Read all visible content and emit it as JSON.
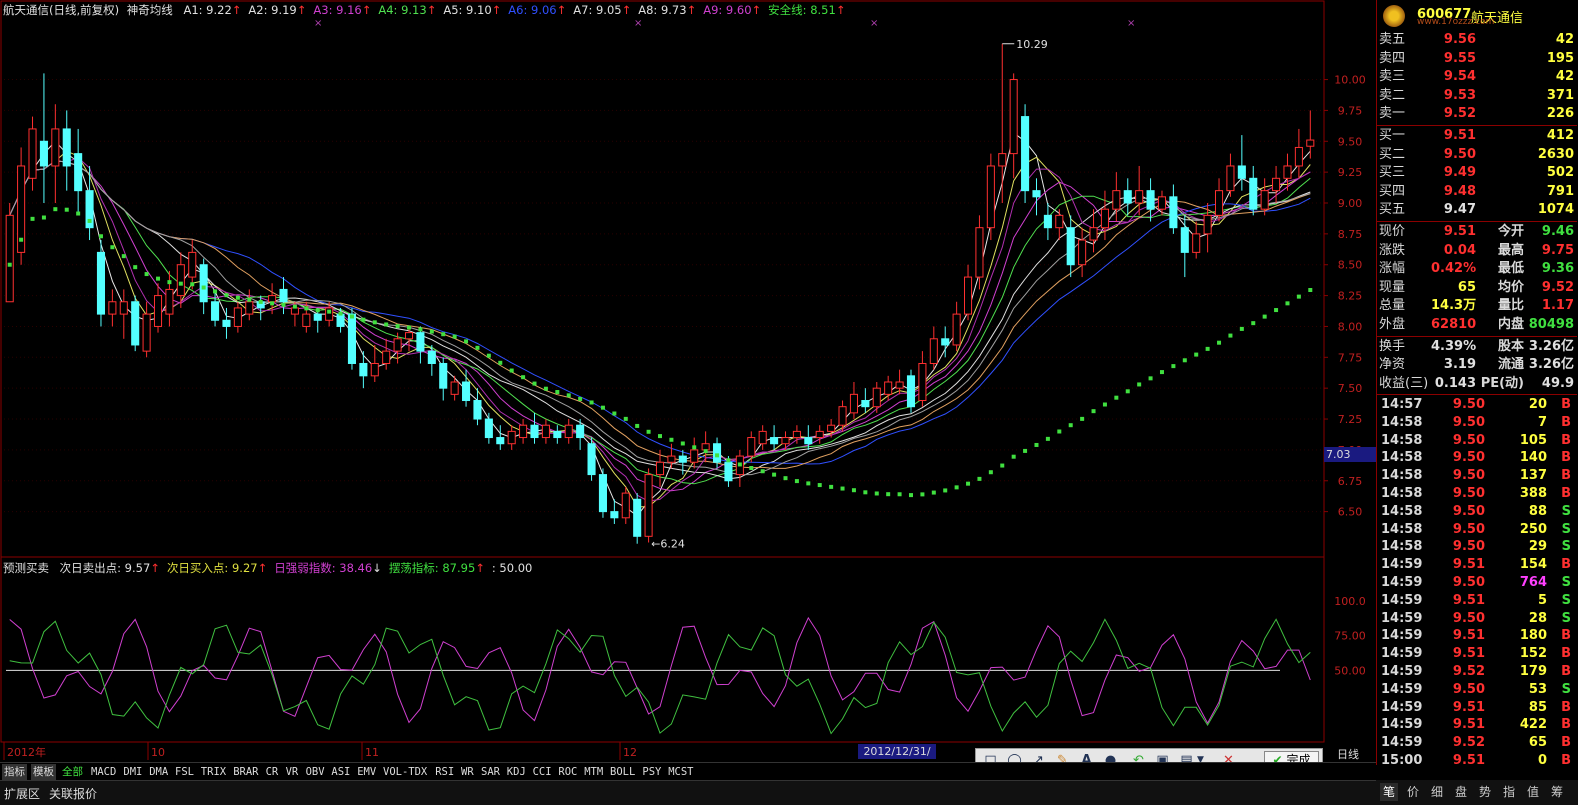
{
  "main_header": {
    "title": "航天通信(日线,前复权)",
    "indicator": "神奇均线",
    "items": [
      {
        "label": "A1: 9.22",
        "arrow": "↑",
        "color": "#e0e0e0"
      },
      {
        "label": "A2: 9.19",
        "arrow": "↑",
        "color": "#e0e0e0"
      },
      {
        "label": "A3: 9.16",
        "arrow": "↑",
        "color": "#d040d0"
      },
      {
        "label": "A4: 9.13",
        "arrow": "↑",
        "color": "#50e050"
      },
      {
        "label": "A5: 9.10",
        "arrow": "↑",
        "color": "#e0e0e0"
      },
      {
        "label": "A6: 9.06",
        "arrow": "↑",
        "color": "#3050ff"
      },
      {
        "label": "A7: 9.05",
        "arrow": "↑",
        "color": "#e0e0e0"
      },
      {
        "label": "A8: 9.73",
        "arrow": "↑",
        "color": "#e0e0e0"
      },
      {
        "label": "A9: 9.60",
        "arrow": "↑",
        "color": "#d040d0"
      },
      {
        "label": "安全线: 8.51",
        "arrow": "↑",
        "color": "#40e040"
      }
    ]
  },
  "sub_header": {
    "title": "预测买卖",
    "items": [
      {
        "label": "次日卖出点: 9.57",
        "arrow": "↑",
        "color": "#e0e0e0"
      },
      {
        "label": "次日买入点: 9.27",
        "arrow": "↑",
        "color": "#e0e040"
      },
      {
        "label": "日强弱指数: 38.46",
        "arrow": "↓",
        "color": "#d040d0"
      },
      {
        "label": "摆荡指标: 87.95",
        "arrow": "↑",
        "color": "#40e040"
      },
      {
        "label": ": 50.00",
        "arrow": "",
        "color": "#e0e0e0"
      }
    ]
  },
  "price_axis": [
    "10.00",
    "9.75",
    "9.50",
    "9.25",
    "9.00",
    "8.75",
    "8.50",
    "8.25",
    "8.00",
    "7.75",
    "7.50",
    "7.25",
    "7.00",
    "6.75",
    "6.50"
  ],
  "crosshair_price": "7.03",
  "osc_axis": [
    "100.0",
    "75.00",
    "50.00"
  ],
  "annotations": {
    "high": "10.29",
    "low": "6.24"
  },
  "time_axis": [
    "2012年",
    "10",
    "11",
    "12"
  ],
  "date_box": "2012/12/31/一",
  "period_label": "日线",
  "stock": {
    "code": "600677",
    "name": "航天通信",
    "watermark": "www.17ozzz.com"
  },
  "asks": [
    {
      "label": "卖五",
      "price": "9.56",
      "vol": "42"
    },
    {
      "label": "卖四",
      "price": "9.55",
      "vol": "195"
    },
    {
      "label": "卖三",
      "price": "9.54",
      "vol": "42"
    },
    {
      "label": "卖二",
      "price": "9.53",
      "vol": "371"
    },
    {
      "label": "卖一",
      "price": "9.52",
      "vol": "226"
    }
  ],
  "bids": [
    {
      "label": "买一",
      "price": "9.51",
      "vol": "412"
    },
    {
      "label": "买二",
      "price": "9.50",
      "vol": "2630"
    },
    {
      "label": "买三",
      "price": "9.49",
      "vol": "502"
    },
    {
      "label": "买四",
      "price": "9.48",
      "vol": "791"
    },
    {
      "label": "买五",
      "price": "9.47",
      "vol": "1074"
    }
  ],
  "quote": [
    {
      "l1": "现价",
      "v1": "9.51",
      "c1": "#ff3030",
      "l2": "今开",
      "v2": "9.46",
      "c2": "#40e040"
    },
    {
      "l1": "涨跌",
      "v1": "0.04",
      "c1": "#ff3030",
      "l2": "最高",
      "v2": "9.75",
      "c2": "#ff3030"
    },
    {
      "l1": "涨幅",
      "v1": "0.42%",
      "c1": "#ff3030",
      "l2": "最低",
      "v2": "9.36",
      "c2": "#40e040"
    },
    {
      "l1": "现量",
      "v1": "65",
      "c1": "#ffff40",
      "l2": "均价",
      "v2": "9.52",
      "c2": "#ff3030"
    },
    {
      "l1": "总量",
      "v1": "14.3万",
      "c1": "#ffff40",
      "l2": "量比",
      "v2": "1.17",
      "c2": "#ff3030"
    },
    {
      "l1": "外盘",
      "v1": "62810",
      "c1": "#ff3030",
      "l2": "内盘",
      "v2": "80498",
      "c2": "#40e040"
    }
  ],
  "fund": [
    {
      "l1": "换手",
      "v1": "4.39%",
      "l2": "股本",
      "v2": "3.26亿"
    },
    {
      "l1": "净资",
      "v1": "3.19",
      "l2": "流通",
      "v2": "3.26亿"
    },
    {
      "l1": "收益(三)",
      "v1": "0.143",
      "l2": "PE(动)",
      "v2": "49.9"
    }
  ],
  "ticks": [
    {
      "t": "14:57",
      "p": "9.50",
      "v": "20",
      "bs": "B",
      "vc": "#ffff40"
    },
    {
      "t": "14:58",
      "p": "9.50",
      "v": "7",
      "bs": "B",
      "vc": "#ffff40"
    },
    {
      "t": "14:58",
      "p": "9.50",
      "v": "105",
      "bs": "B",
      "vc": "#ffff40"
    },
    {
      "t": "14:58",
      "p": "9.50",
      "v": "140",
      "bs": "B",
      "vc": "#ffff40"
    },
    {
      "t": "14:58",
      "p": "9.50",
      "v": "137",
      "bs": "B",
      "vc": "#ffff40"
    },
    {
      "t": "14:58",
      "p": "9.50",
      "v": "388",
      "bs": "B",
      "vc": "#ffff40"
    },
    {
      "t": "14:58",
      "p": "9.50",
      "v": "88",
      "bs": "S",
      "vc": "#ffff40"
    },
    {
      "t": "14:58",
      "p": "9.50",
      "v": "250",
      "bs": "S",
      "vc": "#ffff40"
    },
    {
      "t": "14:58",
      "p": "9.50",
      "v": "29",
      "bs": "S",
      "vc": "#ffff40"
    },
    {
      "t": "14:59",
      "p": "9.51",
      "v": "154",
      "bs": "B",
      "vc": "#ffff40"
    },
    {
      "t": "14:59",
      "p": "9.50",
      "v": "764",
      "bs": "S",
      "vc": "#ff40ff"
    },
    {
      "t": "14:59",
      "p": "9.51",
      "v": "5",
      "bs": "S",
      "vc": "#ffff40"
    },
    {
      "t": "14:59",
      "p": "9.50",
      "v": "28",
      "bs": "S",
      "vc": "#ffff40"
    },
    {
      "t": "14:59",
      "p": "9.51",
      "v": "180",
      "bs": "B",
      "vc": "#ffff40"
    },
    {
      "t": "14:59",
      "p": "9.51",
      "v": "152",
      "bs": "B",
      "vc": "#ffff40"
    },
    {
      "t": "14:59",
      "p": "9.52",
      "v": "179",
      "bs": "B",
      "vc": "#ffff40"
    },
    {
      "t": "14:59",
      "p": "9.50",
      "v": "53",
      "bs": "S",
      "vc": "#ffff40"
    },
    {
      "t": "14:59",
      "p": "9.51",
      "v": "85",
      "bs": "B",
      "vc": "#ffff40"
    },
    {
      "t": "14:59",
      "p": "9.51",
      "v": "422",
      "bs": "B",
      "vc": "#ffff40"
    },
    {
      "t": "14:59",
      "p": "9.52",
      "v": "65",
      "bs": "B",
      "vc": "#ffff40"
    },
    {
      "t": "15:00",
      "p": "9.51",
      "v": "0",
      "bs": "B",
      "vc": "#ffff40"
    }
  ],
  "indicator_tabs": [
    "指标",
    "模板",
    "全部",
    "MACD",
    "DMI",
    "DMA",
    "FSL",
    "TRIX",
    "BRAR",
    "CR",
    "VR",
    "OBV",
    "ASI",
    "EMV",
    "VOL-TDX",
    "RSI",
    "WR",
    "SAR",
    "KDJ",
    "CCI",
    "ROC",
    "MTM",
    "BOLL",
    "PSY",
    "MCST"
  ],
  "bottom_tabs": [
    "扩展区",
    "关联报价"
  ],
  "right_tabs": [
    "笔",
    "价",
    "细",
    "盘",
    "势",
    "指",
    "值",
    "筹"
  ],
  "toolbar_done": "完成",
  "colors": {
    "up": "#ff3030",
    "down": "#54ffff",
    "safety": "#40e040",
    "frame": "#8b0000"
  },
  "chart_data": {
    "type": "line",
    "note_series": "daily OHLC candles (approx)",
    "ohlc": [
      [
        8.2,
        8.9,
        8.2,
        9.0
      ],
      [
        8.6,
        9.3,
        8.5,
        9.45
      ],
      [
        9.2,
        9.6,
        9.1,
        9.7
      ],
      [
        9.5,
        9.3,
        9.0,
        10.05
      ],
      [
        9.3,
        9.6,
        9.0,
        9.8
      ],
      [
        9.6,
        9.3,
        9.1,
        9.75
      ],
      [
        9.4,
        9.1,
        8.9,
        9.6
      ],
      [
        9.1,
        8.8,
        8.7,
        9.3
      ],
      [
        8.6,
        8.1,
        8.0,
        8.7
      ],
      [
        8.1,
        8.2,
        8.0,
        8.3
      ],
      [
        8.1,
        8.2,
        7.9,
        8.3
      ],
      [
        8.2,
        7.85,
        7.8,
        8.25
      ],
      [
        7.8,
        8.1,
        7.75,
        8.2
      ],
      [
        8.0,
        8.25,
        7.95,
        8.35
      ],
      [
        8.1,
        8.3,
        8.0,
        8.45
      ],
      [
        8.25,
        8.5,
        8.15,
        8.6
      ],
      [
        8.4,
        8.6,
        8.3,
        8.7
      ],
      [
        8.5,
        8.2,
        8.1,
        8.55
      ],
      [
        8.2,
        8.05,
        8.0,
        8.3
      ],
      [
        8.05,
        8.0,
        7.9,
        8.15
      ],
      [
        8.0,
        8.15,
        7.95,
        8.2
      ],
      [
        8.1,
        8.2,
        8.05,
        8.3
      ],
      [
        8.2,
        8.15,
        8.05,
        8.25
      ],
      [
        8.2,
        8.25,
        8.1,
        8.35
      ],
      [
        8.3,
        8.2,
        8.1,
        8.4
      ],
      [
        8.1,
        8.15,
        8.0,
        8.2
      ],
      [
        8.0,
        8.1,
        7.95,
        8.2
      ],
      [
        8.1,
        8.05,
        7.95,
        8.15
      ],
      [
        8.05,
        8.15,
        8.0,
        8.2
      ],
      [
        8.1,
        8.0,
        7.95,
        8.15
      ],
      [
        8.1,
        7.7,
        7.65,
        8.15
      ],
      [
        7.7,
        7.6,
        7.5,
        7.8
      ],
      [
        7.6,
        7.7,
        7.55,
        7.85
      ],
      [
        7.7,
        7.8,
        7.65,
        7.9
      ],
      [
        7.8,
        7.9,
        7.7,
        7.95
      ],
      [
        7.9,
        7.95,
        7.8,
        8.0
      ],
      [
        7.95,
        7.8,
        7.7,
        8.0
      ],
      [
        7.8,
        7.7,
        7.6,
        7.85
      ],
      [
        7.7,
        7.5,
        7.4,
        7.75
      ],
      [
        7.45,
        7.55,
        7.4,
        7.6
      ],
      [
        7.55,
        7.4,
        7.35,
        7.65
      ],
      [
        7.4,
        7.25,
        7.2,
        7.5
      ],
      [
        7.25,
        7.1,
        7.05,
        7.3
      ],
      [
        7.1,
        7.05,
        7.0,
        7.2
      ],
      [
        7.05,
        7.15,
        7.0,
        7.2
      ],
      [
        7.1,
        7.2,
        7.05,
        7.25
      ],
      [
        7.2,
        7.1,
        7.05,
        7.3
      ],
      [
        7.1,
        7.2,
        7.05,
        7.25
      ],
      [
        7.15,
        7.1,
        7.05,
        7.2
      ],
      [
        7.1,
        7.2,
        7.05,
        7.25
      ],
      [
        7.2,
        7.1,
        7.0,
        7.25
      ],
      [
        7.05,
        6.8,
        6.75,
        7.1
      ],
      [
        6.8,
        6.5,
        6.45,
        6.85
      ],
      [
        6.5,
        6.45,
        6.4,
        6.6
      ],
      [
        6.45,
        6.65,
        6.4,
        6.7
      ],
      [
        6.6,
        6.3,
        6.24,
        6.65
      ],
      [
        6.3,
        6.8,
        6.25,
        6.85
      ],
      [
        6.8,
        6.9,
        6.7,
        7.0
      ],
      [
        6.9,
        6.95,
        6.85,
        7.05
      ],
      [
        6.95,
        6.9,
        6.8,
        7.0
      ],
      [
        6.9,
        7.0,
        6.85,
        7.1
      ],
      [
        7.0,
        7.05,
        6.9,
        7.15
      ],
      [
        7.05,
        6.9,
        6.85,
        7.1
      ],
      [
        6.9,
        6.75,
        6.7,
        6.95
      ],
      [
        6.8,
        6.95,
        6.7,
        7.0
      ],
      [
        6.95,
        7.1,
        6.9,
        7.15
      ],
      [
        7.05,
        7.15,
        7.0,
        7.2
      ],
      [
        7.1,
        7.05,
        7.0,
        7.2
      ],
      [
        7.05,
        7.1,
        7.0,
        7.15
      ],
      [
        7.1,
        7.15,
        7.05,
        7.2
      ],
      [
        7.1,
        7.05,
        7.0,
        7.2
      ],
      [
        7.1,
        7.15,
        7.05,
        7.2
      ],
      [
        7.15,
        7.2,
        7.1,
        7.25
      ],
      [
        7.2,
        7.35,
        7.15,
        7.4
      ],
      [
        7.3,
        7.45,
        7.25,
        7.55
      ],
      [
        7.4,
        7.35,
        7.3,
        7.5
      ],
      [
        7.35,
        7.5,
        7.3,
        7.55
      ],
      [
        7.45,
        7.55,
        7.4,
        7.6
      ],
      [
        7.5,
        7.55,
        7.45,
        7.65
      ],
      [
        7.6,
        7.35,
        7.3,
        7.65
      ],
      [
        7.4,
        7.7,
        7.35,
        7.8
      ],
      [
        7.7,
        7.9,
        7.65,
        8.0
      ],
      [
        7.9,
        7.85,
        7.75,
        8.0
      ],
      [
        7.85,
        8.1,
        7.8,
        8.2
      ],
      [
        8.1,
        8.4,
        8.05,
        8.5
      ],
      [
        8.4,
        8.8,
        8.3,
        8.9
      ],
      [
        8.8,
        9.3,
        8.7,
        9.4
      ],
      [
        9.3,
        9.4,
        9.0,
        10.29
      ],
      [
        9.4,
        10.0,
        9.2,
        10.05
      ],
      [
        9.7,
        9.1,
        9.0,
        9.8
      ],
      [
        9.1,
        9.05,
        8.9,
        9.2
      ],
      [
        8.9,
        8.8,
        8.7,
        9.0
      ],
      [
        8.8,
        8.9,
        8.7,
        8.95
      ],
      [
        8.8,
        8.5,
        8.4,
        8.9
      ],
      [
        8.5,
        8.7,
        8.4,
        8.8
      ],
      [
        8.7,
        8.8,
        8.6,
        8.95
      ],
      [
        8.8,
        8.95,
        8.7,
        9.1
      ],
      [
        8.95,
        9.1,
        8.85,
        9.25
      ],
      [
        9.1,
        9.0,
        8.9,
        9.2
      ],
      [
        9.0,
        9.1,
        8.9,
        9.3
      ],
      [
        9.1,
        8.95,
        8.85,
        9.2
      ],
      [
        8.95,
        9.05,
        8.9,
        9.1
      ],
      [
        9.05,
        8.8,
        8.75,
        9.15
      ],
      [
        8.8,
        8.6,
        8.4,
        8.9
      ],
      [
        8.6,
        8.75,
        8.55,
        8.85
      ],
      [
        8.75,
        8.9,
        8.6,
        9.0
      ],
      [
        8.9,
        9.1,
        8.85,
        9.2
      ],
      [
        9.1,
        9.3,
        9.05,
        9.4
      ],
      [
        9.3,
        9.2,
        9.1,
        9.55
      ],
      [
        9.2,
        8.95,
        8.9,
        9.3
      ],
      [
        8.95,
        9.1,
        8.9,
        9.2
      ],
      [
        9.1,
        9.2,
        9.0,
        9.3
      ],
      [
        9.2,
        9.3,
        9.1,
        9.4
      ],
      [
        9.3,
        9.45,
        9.2,
        9.6
      ],
      [
        9.46,
        9.51,
        9.36,
        9.75
      ]
    ]
  }
}
